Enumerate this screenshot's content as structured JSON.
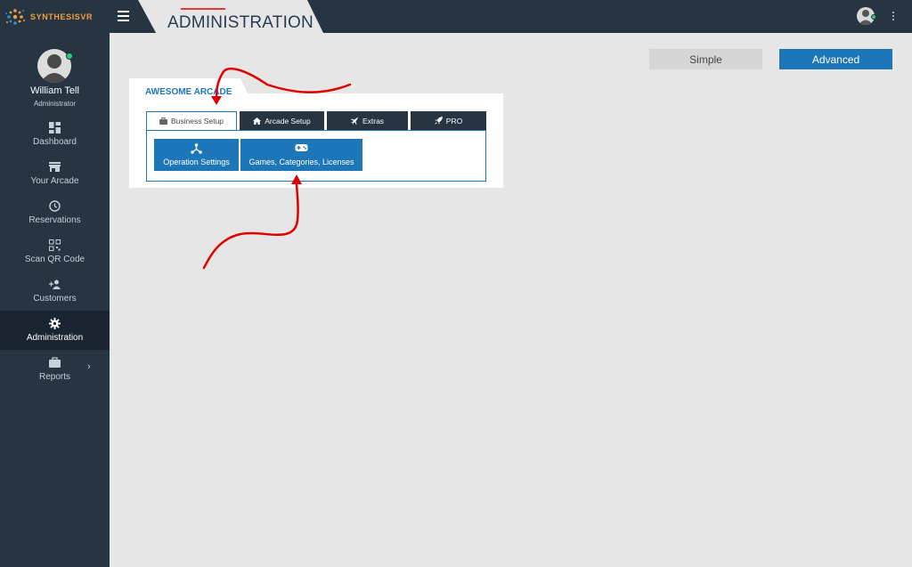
{
  "app": {
    "brand": "SYNTHESISVR",
    "page_title": "ADMINISTRATION"
  },
  "colors": {
    "sidebar_bg": "#273442",
    "accent_blue": "#1d76b8",
    "annotation_red": "#e00000",
    "status_green": "#2ecc71"
  },
  "user": {
    "name": "William Tell",
    "role": "Administrator"
  },
  "sidebar": {
    "items": [
      {
        "label": "Dashboard",
        "icon": "dashboard-icon"
      },
      {
        "label": "Your Arcade",
        "icon": "store-icon"
      },
      {
        "label": "Reservations",
        "icon": "clock-icon"
      },
      {
        "label": "Scan QR Code",
        "icon": "qr-code-icon"
      },
      {
        "label": "Customers",
        "icon": "add-person-icon"
      },
      {
        "label": "Administration",
        "icon": "gear-icon",
        "active": true
      },
      {
        "label": "Reports",
        "icon": "briefcase-icon"
      }
    ]
  },
  "mode_toggle": {
    "simple": "Simple",
    "advanced": "Advanced",
    "selected": "Advanced"
  },
  "card": {
    "title": "AWESOME ARCADE",
    "tabs": [
      {
        "label": "Business Setup",
        "icon": "briefcase-icon",
        "active": true
      },
      {
        "label": "Arcade Setup",
        "icon": "home-icon"
      },
      {
        "label": "Extras",
        "icon": "plane-icon"
      },
      {
        "label": "PRO",
        "icon": "rocket-icon"
      }
    ],
    "tiles": [
      {
        "label": "Operation Settings",
        "icon": "hub-icon"
      },
      {
        "label": "Games, Categories, Licenses",
        "icon": "gamepad-icon"
      }
    ]
  }
}
